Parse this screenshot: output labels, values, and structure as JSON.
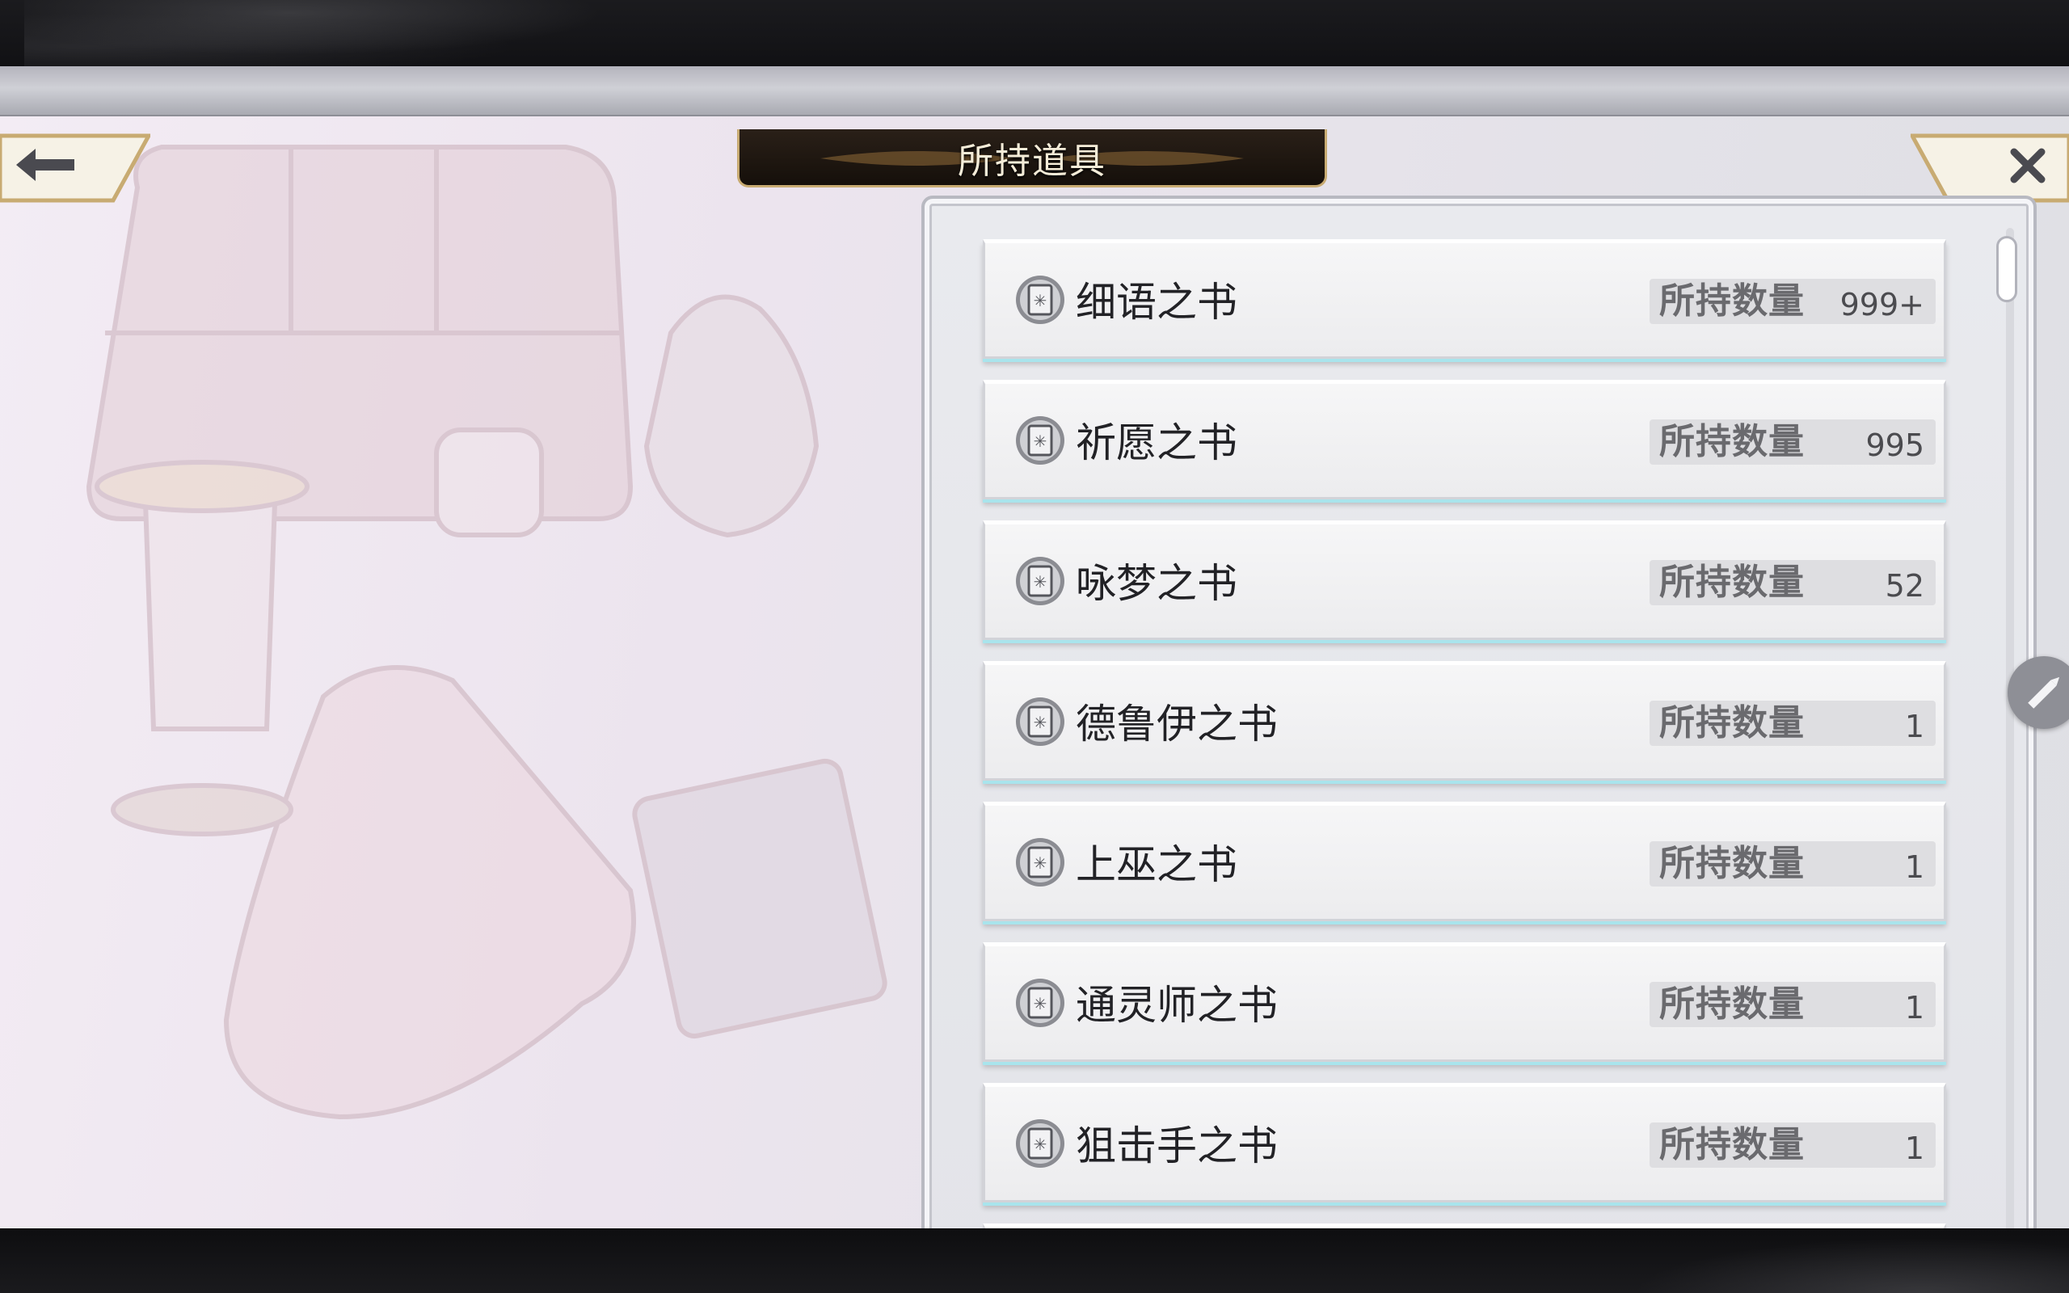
{
  "header": {
    "title": "所持道具",
    "back_icon": "arrow-left-icon",
    "close_icon": "close-icon"
  },
  "items": [
    {
      "name": "细语之书",
      "count_label": "所持数量",
      "count": "999+",
      "icon": "book-icon"
    },
    {
      "name": "祈愿之书",
      "count_label": "所持数量",
      "count": "995",
      "icon": "book-icon"
    },
    {
      "name": "咏梦之书",
      "count_label": "所持数量",
      "count": "52",
      "icon": "book-icon"
    },
    {
      "name": "德鲁伊之书",
      "count_label": "所持数量",
      "count": "1",
      "icon": "book-icon"
    },
    {
      "name": "上巫之书",
      "count_label": "所持数量",
      "count": "1",
      "icon": "book-icon"
    },
    {
      "name": "通灵师之书",
      "count_label": "所持数量",
      "count": "1",
      "icon": "book-icon"
    },
    {
      "name": "狙击手之书",
      "count_label": "所持数量",
      "count": "1",
      "icon": "book-icon"
    }
  ],
  "side": {
    "edit_icon": "pencil-icon"
  },
  "colors": {
    "accent_gold": "#c8ab72",
    "row_underline": "#a9e4ec",
    "panel_bg": "#e9eaee"
  }
}
